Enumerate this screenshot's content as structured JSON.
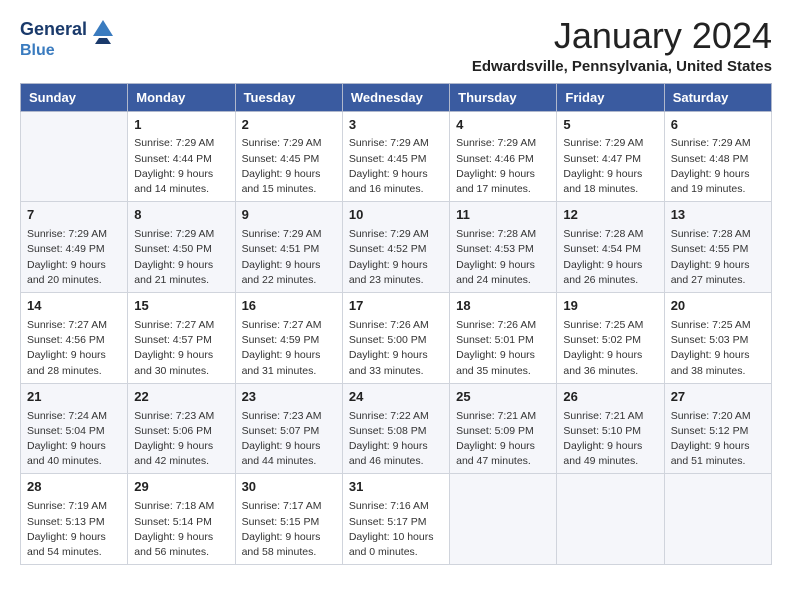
{
  "header": {
    "logo_line1": "General",
    "logo_line2": "Blue",
    "month_title": "January 2024",
    "location": "Edwardsville, Pennsylvania, United States"
  },
  "weekdays": [
    "Sunday",
    "Monday",
    "Tuesday",
    "Wednesday",
    "Thursday",
    "Friday",
    "Saturday"
  ],
  "weeks": [
    [
      {
        "day": "",
        "sunrise": "",
        "sunset": "",
        "daylight": ""
      },
      {
        "day": "1",
        "sunrise": "Sunrise: 7:29 AM",
        "sunset": "Sunset: 4:44 PM",
        "daylight": "Daylight: 9 hours and 14 minutes."
      },
      {
        "day": "2",
        "sunrise": "Sunrise: 7:29 AM",
        "sunset": "Sunset: 4:45 PM",
        "daylight": "Daylight: 9 hours and 15 minutes."
      },
      {
        "day": "3",
        "sunrise": "Sunrise: 7:29 AM",
        "sunset": "Sunset: 4:45 PM",
        "daylight": "Daylight: 9 hours and 16 minutes."
      },
      {
        "day": "4",
        "sunrise": "Sunrise: 7:29 AM",
        "sunset": "Sunset: 4:46 PM",
        "daylight": "Daylight: 9 hours and 17 minutes."
      },
      {
        "day": "5",
        "sunrise": "Sunrise: 7:29 AM",
        "sunset": "Sunset: 4:47 PM",
        "daylight": "Daylight: 9 hours and 18 minutes."
      },
      {
        "day": "6",
        "sunrise": "Sunrise: 7:29 AM",
        "sunset": "Sunset: 4:48 PM",
        "daylight": "Daylight: 9 hours and 19 minutes."
      }
    ],
    [
      {
        "day": "7",
        "sunrise": "Sunrise: 7:29 AM",
        "sunset": "Sunset: 4:49 PM",
        "daylight": "Daylight: 9 hours and 20 minutes."
      },
      {
        "day": "8",
        "sunrise": "Sunrise: 7:29 AM",
        "sunset": "Sunset: 4:50 PM",
        "daylight": "Daylight: 9 hours and 21 minutes."
      },
      {
        "day": "9",
        "sunrise": "Sunrise: 7:29 AM",
        "sunset": "Sunset: 4:51 PM",
        "daylight": "Daylight: 9 hours and 22 minutes."
      },
      {
        "day": "10",
        "sunrise": "Sunrise: 7:29 AM",
        "sunset": "Sunset: 4:52 PM",
        "daylight": "Daylight: 9 hours and 23 minutes."
      },
      {
        "day": "11",
        "sunrise": "Sunrise: 7:28 AM",
        "sunset": "Sunset: 4:53 PM",
        "daylight": "Daylight: 9 hours and 24 minutes."
      },
      {
        "day": "12",
        "sunrise": "Sunrise: 7:28 AM",
        "sunset": "Sunset: 4:54 PM",
        "daylight": "Daylight: 9 hours and 26 minutes."
      },
      {
        "day": "13",
        "sunrise": "Sunrise: 7:28 AM",
        "sunset": "Sunset: 4:55 PM",
        "daylight": "Daylight: 9 hours and 27 minutes."
      }
    ],
    [
      {
        "day": "14",
        "sunrise": "Sunrise: 7:27 AM",
        "sunset": "Sunset: 4:56 PM",
        "daylight": "Daylight: 9 hours and 28 minutes."
      },
      {
        "day": "15",
        "sunrise": "Sunrise: 7:27 AM",
        "sunset": "Sunset: 4:57 PM",
        "daylight": "Daylight: 9 hours and 30 minutes."
      },
      {
        "day": "16",
        "sunrise": "Sunrise: 7:27 AM",
        "sunset": "Sunset: 4:59 PM",
        "daylight": "Daylight: 9 hours and 31 minutes."
      },
      {
        "day": "17",
        "sunrise": "Sunrise: 7:26 AM",
        "sunset": "Sunset: 5:00 PM",
        "daylight": "Daylight: 9 hours and 33 minutes."
      },
      {
        "day": "18",
        "sunrise": "Sunrise: 7:26 AM",
        "sunset": "Sunset: 5:01 PM",
        "daylight": "Daylight: 9 hours and 35 minutes."
      },
      {
        "day": "19",
        "sunrise": "Sunrise: 7:25 AM",
        "sunset": "Sunset: 5:02 PM",
        "daylight": "Daylight: 9 hours and 36 minutes."
      },
      {
        "day": "20",
        "sunrise": "Sunrise: 7:25 AM",
        "sunset": "Sunset: 5:03 PM",
        "daylight": "Daylight: 9 hours and 38 minutes."
      }
    ],
    [
      {
        "day": "21",
        "sunrise": "Sunrise: 7:24 AM",
        "sunset": "Sunset: 5:04 PM",
        "daylight": "Daylight: 9 hours and 40 minutes."
      },
      {
        "day": "22",
        "sunrise": "Sunrise: 7:23 AM",
        "sunset": "Sunset: 5:06 PM",
        "daylight": "Daylight: 9 hours and 42 minutes."
      },
      {
        "day": "23",
        "sunrise": "Sunrise: 7:23 AM",
        "sunset": "Sunset: 5:07 PM",
        "daylight": "Daylight: 9 hours and 44 minutes."
      },
      {
        "day": "24",
        "sunrise": "Sunrise: 7:22 AM",
        "sunset": "Sunset: 5:08 PM",
        "daylight": "Daylight: 9 hours and 46 minutes."
      },
      {
        "day": "25",
        "sunrise": "Sunrise: 7:21 AM",
        "sunset": "Sunset: 5:09 PM",
        "daylight": "Daylight: 9 hours and 47 minutes."
      },
      {
        "day": "26",
        "sunrise": "Sunrise: 7:21 AM",
        "sunset": "Sunset: 5:10 PM",
        "daylight": "Daylight: 9 hours and 49 minutes."
      },
      {
        "day": "27",
        "sunrise": "Sunrise: 7:20 AM",
        "sunset": "Sunset: 5:12 PM",
        "daylight": "Daylight: 9 hours and 51 minutes."
      }
    ],
    [
      {
        "day": "28",
        "sunrise": "Sunrise: 7:19 AM",
        "sunset": "Sunset: 5:13 PM",
        "daylight": "Daylight: 9 hours and 54 minutes."
      },
      {
        "day": "29",
        "sunrise": "Sunrise: 7:18 AM",
        "sunset": "Sunset: 5:14 PM",
        "daylight": "Daylight: 9 hours and 56 minutes."
      },
      {
        "day": "30",
        "sunrise": "Sunrise: 7:17 AM",
        "sunset": "Sunset: 5:15 PM",
        "daylight": "Daylight: 9 hours and 58 minutes."
      },
      {
        "day": "31",
        "sunrise": "Sunrise: 7:16 AM",
        "sunset": "Sunset: 5:17 PM",
        "daylight": "Daylight: 10 hours and 0 minutes."
      },
      {
        "day": "",
        "sunrise": "",
        "sunset": "",
        "daylight": ""
      },
      {
        "day": "",
        "sunrise": "",
        "sunset": "",
        "daylight": ""
      },
      {
        "day": "",
        "sunrise": "",
        "sunset": "",
        "daylight": ""
      }
    ]
  ]
}
